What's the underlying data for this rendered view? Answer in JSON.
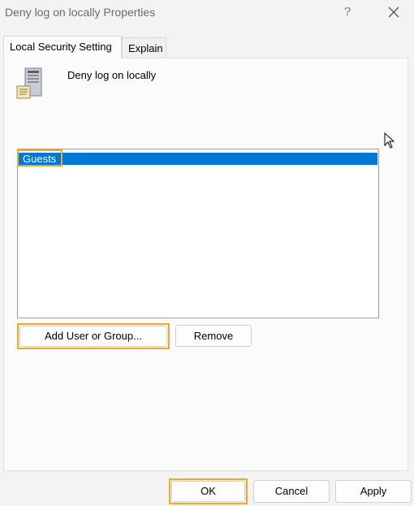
{
  "window": {
    "title": "Deny log on locally Properties",
    "help_icon": "?",
    "close_icon": "close-icon"
  },
  "tabs": [
    {
      "label": "Local Security Setting",
      "active": true
    },
    {
      "label": "Explain",
      "active": false
    }
  ],
  "policy": {
    "name": "Deny log on locally",
    "icon": "server-icon"
  },
  "members": {
    "items": [
      {
        "label": "Guests",
        "selected": true
      }
    ]
  },
  "buttons": {
    "add": "Add User or Group...",
    "remove": "Remove",
    "ok": "OK",
    "cancel": "Cancel",
    "apply": "Apply"
  },
  "colors": {
    "selection": "#0078d7",
    "highlight": "#f5a623"
  }
}
